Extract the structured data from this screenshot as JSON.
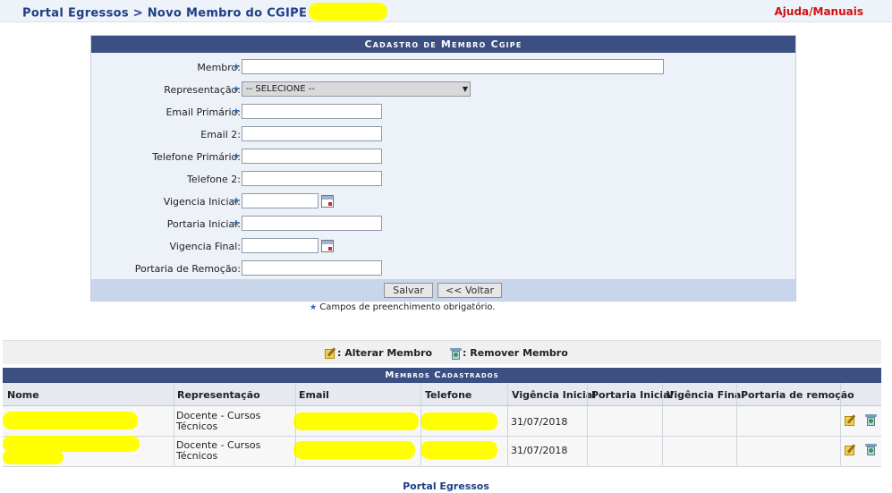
{
  "header": {
    "breadcrumb": "Portal Egressos > Novo Membro do CGIPE",
    "help": "Ajuda/Manuais"
  },
  "form": {
    "title": "Cadastro de Membro Cgipe",
    "fields": {
      "membro": "Membro:",
      "representacao": "Representação:",
      "email1": "Email Primário:",
      "email2": "Email 2:",
      "telefone1": "Telefone Primário:",
      "telefone2": "Telefone 2:",
      "vig_ini": "Vigencia Inicial:",
      "port_ini": "Portaria Inicial:",
      "vig_fim": "Vigencia Final:",
      "port_rem": "Portaria de Remoção:"
    },
    "select_value": "-- SELECIONE --",
    "save": "Salvar",
    "back": "<< Voltar",
    "required_note": "Campos de preenchimento obrigatório."
  },
  "legend": {
    "edit": ": Alterar Membro",
    "remove": ": Remover Membro"
  },
  "table": {
    "title": "Membros Cadastrados",
    "columns": [
      "Nome",
      "Representação",
      "Email",
      "Telefone",
      "Vigência Inicial",
      "Portaria Inicial",
      "Vigência Final",
      "Portaria de remoção"
    ],
    "rows": [
      {
        "representacao_1": "Docente - Cursos",
        "representacao_2": "Técnicos",
        "vigencia": "31/07/2018"
      },
      {
        "representacao_1": "Docente - Cursos",
        "representacao_2": "Técnicos",
        "vigencia": "31/07/2018"
      }
    ]
  },
  "footer": "Portal Egressos",
  "colors": {
    "header_blue": "#3b4f82",
    "link_blue": "#1e3f86",
    "help_red": "#d01010",
    "redaction": "#ffff00"
  }
}
